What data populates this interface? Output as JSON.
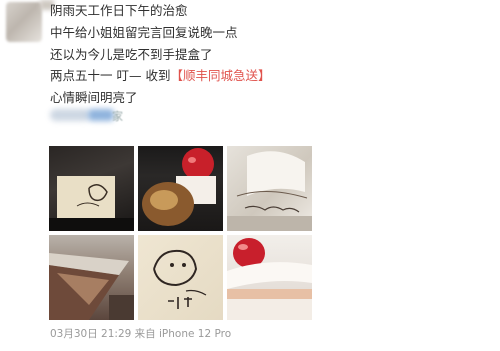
{
  "post": {
    "lines": [
      "阴雨天工作日下午的治愈",
      "中午给小姐姐留完言回复说晚一点",
      "还以为今儿是吃不到手提盒了",
      "心情瞬间明亮了"
    ],
    "line4_prefix": "两点五十一 叮— 收到",
    "line4_bracket_open": "【",
    "line4_link": "顺丰同城急送",
    "line4_bracket_close": "】",
    "blurred_tail": "家",
    "photos": [
      {
        "alt": "黑色盒子里的手提盒与手绘插画贴纸"
      },
      {
        "alt": "草莓蛋糕与烤面包"
      },
      {
        "alt": "奶油蛋糕侧面手写字"
      },
      {
        "alt": "芒果/巧克力切片蛋糕"
      },
      {
        "alt": "手绘猫咪图案纸盒"
      },
      {
        "alt": "草莓奶油蛋糕特写"
      }
    ],
    "meta": "03月30日 21:29  来自 iPhone 12 Pro"
  },
  "colors": {
    "link": "#e0524c",
    "meta": "#9a9a9a",
    "text": "#2f2f2f"
  }
}
